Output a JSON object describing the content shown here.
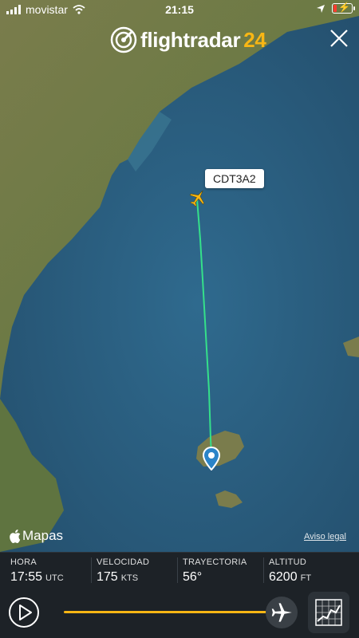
{
  "status_bar": {
    "carrier": "movistar",
    "time": "21:15"
  },
  "brand": {
    "name_main": "flightradar",
    "name_num": "24"
  },
  "map": {
    "flight_callsign": "CDT3A2",
    "maps_logo_text": "Mapas",
    "legal_link": "Aviso legal",
    "track_color": "#35e08a",
    "plane_color": "#f8b614"
  },
  "stats": [
    {
      "label": "HORA",
      "value": "17:55",
      "unit": "UTC"
    },
    {
      "label": "VELOCIDAD",
      "value": "175",
      "unit": "KTS"
    },
    {
      "label": "TRAYECTORIA",
      "value": "56°",
      "unit": ""
    },
    {
      "label": "ALTITUD",
      "value": "6200",
      "unit": "FT"
    }
  ],
  "playback": {
    "progress": 1.0,
    "accent": "#f8b614"
  },
  "icons": {
    "close": "close-icon",
    "play": "play-icon",
    "plane": "plane-icon",
    "chart": "chart-icon",
    "pin": "location-pin-icon",
    "apple": "apple-icon",
    "wifi": "wifi-icon",
    "location": "location-arrow-icon",
    "battery": "battery-icon"
  }
}
